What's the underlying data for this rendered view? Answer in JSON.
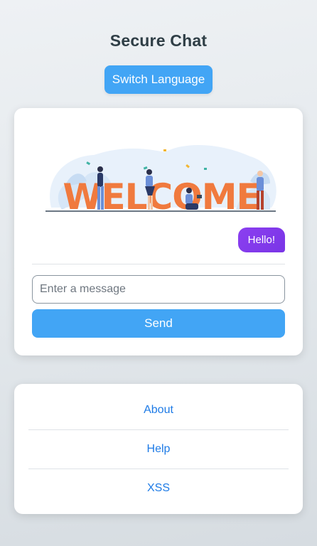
{
  "header": {
    "title": "Secure Chat",
    "switch_language_label": "Switch Language"
  },
  "chat": {
    "illustration_text": "WELCOME",
    "messages": [
      {
        "text": "Hello!",
        "from": "self"
      }
    ],
    "input": {
      "value": "",
      "placeholder": "Enter a message"
    },
    "send_label": "Send"
  },
  "links": {
    "items": [
      {
        "label": "About"
      },
      {
        "label": "Help"
      },
      {
        "label": "XSS"
      }
    ]
  },
  "colors": {
    "accent": "#42a5f5",
    "bubble": "#7c3aed",
    "link": "#1e7be6",
    "welcome_letters": "#f07a3e"
  }
}
